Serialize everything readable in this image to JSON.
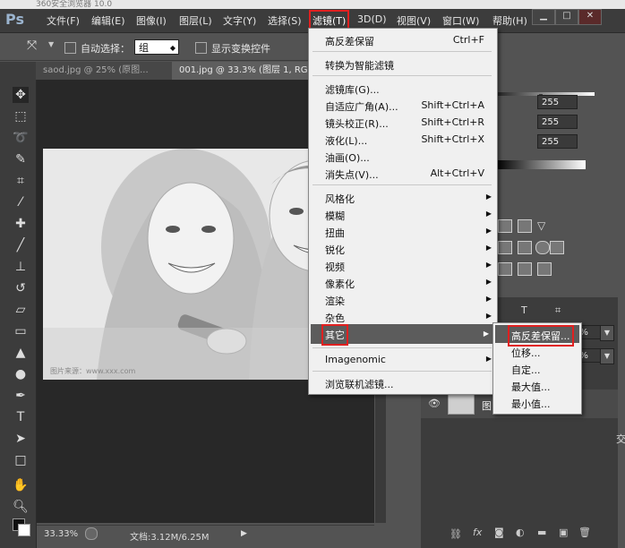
{
  "browser": {
    "title": "360安全浏览器 10.0"
  },
  "app": {
    "logo": "Ps"
  },
  "menubar": {
    "items": [
      "文件(F)",
      "编辑(E)",
      "图像(I)",
      "图层(L)",
      "文字(Y)",
      "选择(S)",
      "滤镜(T)",
      "3D(D)",
      "视图(V)",
      "窗口(W)",
      "帮助(H)"
    ]
  },
  "window_controls": {
    "minimize": "▁",
    "restore": "□",
    "close": "✕"
  },
  "options_bar": {
    "auto_select": "自动选择：",
    "group_value": "组",
    "show_transform": "显示变换控件"
  },
  "tabs": [
    "saod.jpg @ 25% (原图...",
    "001.jpg @ 33.3% (图层 1, RGB"
  ],
  "filter_menu": {
    "top_items": [
      {
        "label": "高反差保留",
        "shortcut": "Ctrl+F"
      },
      {
        "label": "转换为智能滤镜",
        "shortcut": ""
      }
    ],
    "mid_items": [
      {
        "label": "滤镜库(G)...",
        "shortcut": ""
      },
      {
        "label": "自适应广角(A)...",
        "shortcut": "Shift+Ctrl+A"
      },
      {
        "label": "镜头校正(R)...",
        "shortcut": "Shift+Ctrl+R"
      },
      {
        "label": "液化(L)...",
        "shortcut": "Shift+Ctrl+X"
      },
      {
        "label": "油画(O)...",
        "shortcut": ""
      },
      {
        "label": "消失点(V)...",
        "shortcut": "Alt+Ctrl+V"
      }
    ],
    "sub_items": [
      "风格化",
      "模糊",
      "扭曲",
      "锐化",
      "视频",
      "像素化",
      "渲染",
      "杂色",
      "其它"
    ],
    "imagenomic": "Imagenomic",
    "browse_online": "浏览联机滤镜..."
  },
  "other_submenu": [
    "高反差保留...",
    "位移...",
    "自定...",
    "最大值...",
    "最小值..."
  ],
  "status": {
    "zoom": "33.33%",
    "doc": "文档:3.12M/6.25M"
  },
  "right_panel": {
    "levels": [
      "255",
      "255",
      "255"
    ],
    "opacity_1": "0%",
    "opacity_2": "0%",
    "layer_name": "图",
    "side_text": "交"
  },
  "watermark": "图片来源：www.xxx.com"
}
